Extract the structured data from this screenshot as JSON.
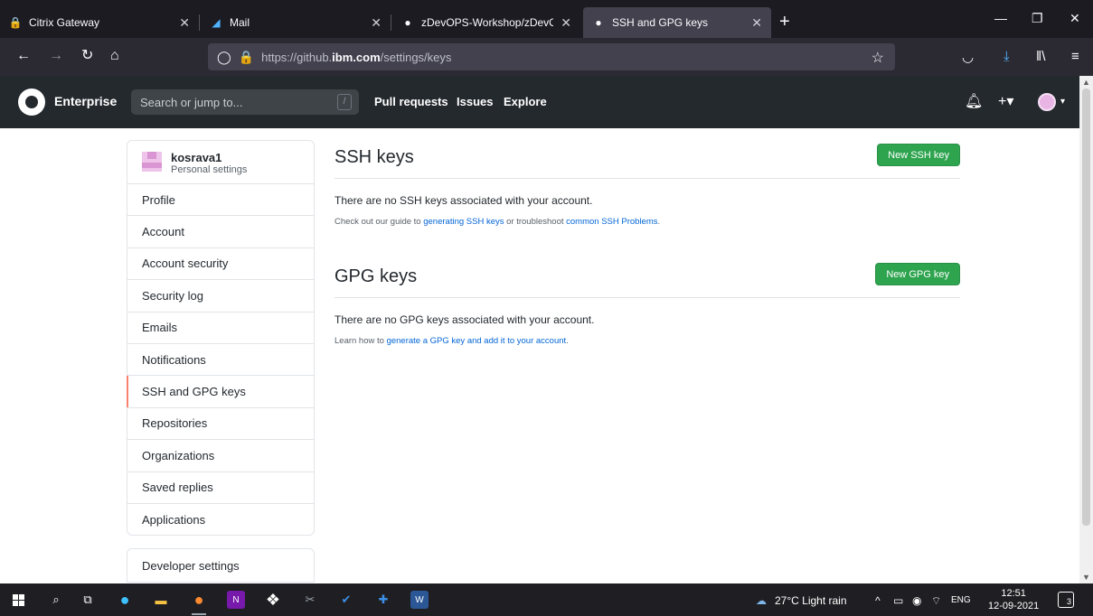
{
  "browser": {
    "tabs": [
      {
        "title": "Citrix Gateway",
        "icon": "lock-icon"
      },
      {
        "title": "Mail",
        "icon": "mail-icon"
      },
      {
        "title": "zDevOPS-Workshop/zDevOPS",
        "icon": "github-icon"
      },
      {
        "title": "SSH and GPG keys",
        "icon": "github-icon",
        "active": true
      }
    ],
    "url": {
      "prefix": "https://github.",
      "host": "ibm.com",
      "path": "/settings/keys"
    }
  },
  "github": {
    "brand": "Enterprise",
    "search_placeholder": "Search or jump to...",
    "search_shortcut": "/",
    "nav": [
      "Pull requests",
      "Issues",
      "Explore"
    ]
  },
  "sidebar": {
    "username": "kosrava1",
    "subtitle": "Personal settings",
    "items": [
      {
        "label": "Profile"
      },
      {
        "label": "Account"
      },
      {
        "label": "Account security"
      },
      {
        "label": "Security log"
      },
      {
        "label": "Emails"
      },
      {
        "label": "Notifications"
      },
      {
        "label": "SSH and GPG keys",
        "selected": true
      },
      {
        "label": "Repositories"
      },
      {
        "label": "Organizations"
      },
      {
        "label": "Saved replies"
      },
      {
        "label": "Applications"
      }
    ],
    "developer_settings": "Developer settings"
  },
  "ssh": {
    "title": "SSH keys",
    "button": "New SSH key",
    "empty": "There are no SSH keys associated with your account.",
    "hint_pre": "Check out our guide to ",
    "hint_link1": "generating SSH keys",
    "hint_mid": " or troubleshoot ",
    "hint_link2": "common SSH Problems",
    "hint_post": "."
  },
  "gpg": {
    "title": "GPG keys",
    "button": "New GPG key",
    "empty": "There are no GPG keys associated with your account.",
    "hint_pre": "Learn how to ",
    "hint_link": "generate a GPG key and add it to your account",
    "hint_post": "."
  },
  "taskbar": {
    "weather": "27°C  Light rain",
    "language": "ENG",
    "time": "12:51",
    "date": "12-09-2021",
    "notifications": "3"
  },
  "colors": {
    "accent_green": "#2ea44f",
    "link_blue": "#0366d6",
    "selected_marker": "#f9826c"
  }
}
